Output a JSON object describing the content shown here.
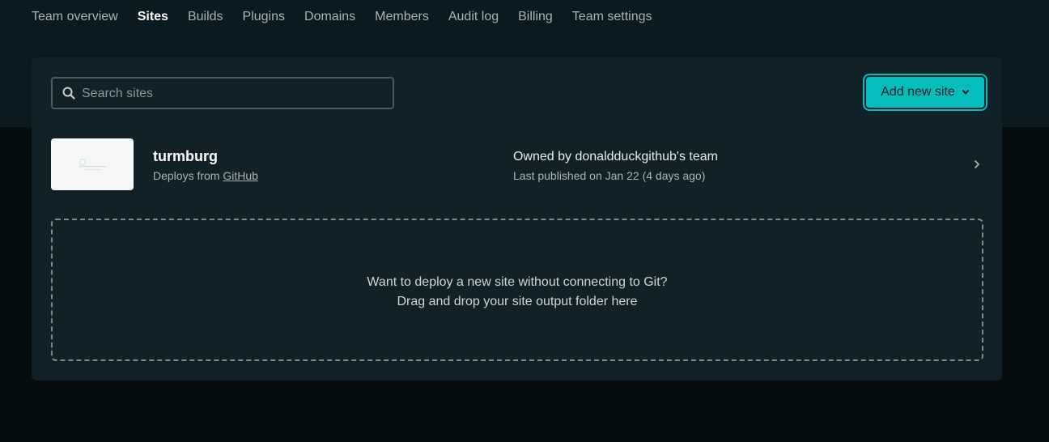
{
  "nav": {
    "items": [
      {
        "label": "Team overview",
        "active": false
      },
      {
        "label": "Sites",
        "active": true
      },
      {
        "label": "Builds",
        "active": false
      },
      {
        "label": "Plugins",
        "active": false
      },
      {
        "label": "Domains",
        "active": false
      },
      {
        "label": "Members",
        "active": false
      },
      {
        "label": "Audit log",
        "active": false
      },
      {
        "label": "Billing",
        "active": false
      },
      {
        "label": "Team settings",
        "active": false
      }
    ]
  },
  "search": {
    "placeholder": "Search sites",
    "value": ""
  },
  "add_button": {
    "label": "Add new site"
  },
  "sites": [
    {
      "name": "turmburg",
      "deploys_prefix": "Deploys from",
      "deploys_source": "GitHub",
      "owner": "Owned by donaldduckgithub's team",
      "published": "Last published on Jan 22 (4 days ago)"
    }
  ],
  "dropzone": {
    "line1": "Want to deploy a new site without connecting to Git?",
    "line2": "Drag and drop your site output folder here"
  },
  "colors": {
    "accent": "#05bdba",
    "background": "#060d11",
    "card": "#112128",
    "header_band": "#0a1a21"
  },
  "icons": [
    "search-icon",
    "chevron-down-icon",
    "chevron-right-icon"
  ]
}
